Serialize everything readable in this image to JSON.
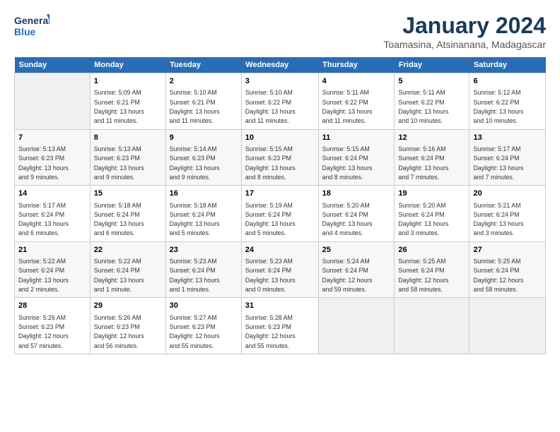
{
  "logo": {
    "line1": "General",
    "line2": "Blue"
  },
  "header": {
    "title": "January 2024",
    "subtitle": "Toamasina, Atsinanana, Madagascar"
  },
  "days_of_week": [
    "Sunday",
    "Monday",
    "Tuesday",
    "Wednesday",
    "Thursday",
    "Friday",
    "Saturday"
  ],
  "weeks": [
    [
      {
        "day": "",
        "info": ""
      },
      {
        "day": "1",
        "info": "Sunrise: 5:09 AM\nSunset: 6:21 PM\nDaylight: 13 hours\nand 11 minutes."
      },
      {
        "day": "2",
        "info": "Sunrise: 5:10 AM\nSunset: 6:21 PM\nDaylight: 13 hours\nand 11 minutes."
      },
      {
        "day": "3",
        "info": "Sunrise: 5:10 AM\nSunset: 6:22 PM\nDaylight: 13 hours\nand 11 minutes."
      },
      {
        "day": "4",
        "info": "Sunrise: 5:11 AM\nSunset: 6:22 PM\nDaylight: 13 hours\nand 11 minutes."
      },
      {
        "day": "5",
        "info": "Sunrise: 5:11 AM\nSunset: 6:22 PM\nDaylight: 13 hours\nand 10 minutes."
      },
      {
        "day": "6",
        "info": "Sunrise: 5:12 AM\nSunset: 6:22 PM\nDaylight: 13 hours\nand 10 minutes."
      }
    ],
    [
      {
        "day": "7",
        "info": "Sunrise: 5:13 AM\nSunset: 6:23 PM\nDaylight: 13 hours\nand 9 minutes."
      },
      {
        "day": "8",
        "info": "Sunrise: 5:13 AM\nSunset: 6:23 PM\nDaylight: 13 hours\nand 9 minutes."
      },
      {
        "day": "9",
        "info": "Sunrise: 5:14 AM\nSunset: 6:23 PM\nDaylight: 13 hours\nand 9 minutes."
      },
      {
        "day": "10",
        "info": "Sunrise: 5:15 AM\nSunset: 6:23 PM\nDaylight: 13 hours\nand 8 minutes."
      },
      {
        "day": "11",
        "info": "Sunrise: 5:15 AM\nSunset: 6:24 PM\nDaylight: 13 hours\nand 8 minutes."
      },
      {
        "day": "12",
        "info": "Sunrise: 5:16 AM\nSunset: 6:24 PM\nDaylight: 13 hours\nand 7 minutes."
      },
      {
        "day": "13",
        "info": "Sunrise: 5:17 AM\nSunset: 6:24 PM\nDaylight: 13 hours\nand 7 minutes."
      }
    ],
    [
      {
        "day": "14",
        "info": "Sunrise: 5:17 AM\nSunset: 6:24 PM\nDaylight: 13 hours\nand 6 minutes."
      },
      {
        "day": "15",
        "info": "Sunrise: 5:18 AM\nSunset: 6:24 PM\nDaylight: 13 hours\nand 6 minutes."
      },
      {
        "day": "16",
        "info": "Sunrise: 5:18 AM\nSunset: 6:24 PM\nDaylight: 13 hours\nand 5 minutes."
      },
      {
        "day": "17",
        "info": "Sunrise: 5:19 AM\nSunset: 6:24 PM\nDaylight: 13 hours\nand 5 minutes."
      },
      {
        "day": "18",
        "info": "Sunrise: 5:20 AM\nSunset: 6:24 PM\nDaylight: 13 hours\nand 4 minutes."
      },
      {
        "day": "19",
        "info": "Sunrise: 5:20 AM\nSunset: 6:24 PM\nDaylight: 13 hours\nand 3 minutes."
      },
      {
        "day": "20",
        "info": "Sunrise: 5:21 AM\nSunset: 6:24 PM\nDaylight: 13 hours\nand 3 minutes."
      }
    ],
    [
      {
        "day": "21",
        "info": "Sunrise: 5:22 AM\nSunset: 6:24 PM\nDaylight: 13 hours\nand 2 minutes."
      },
      {
        "day": "22",
        "info": "Sunrise: 5:22 AM\nSunset: 6:24 PM\nDaylight: 13 hours\nand 1 minute."
      },
      {
        "day": "23",
        "info": "Sunrise: 5:23 AM\nSunset: 6:24 PM\nDaylight: 13 hours\nand 1 minutes."
      },
      {
        "day": "24",
        "info": "Sunrise: 5:23 AM\nSunset: 6:24 PM\nDaylight: 13 hours\nand 0 minutes."
      },
      {
        "day": "25",
        "info": "Sunrise: 5:24 AM\nSunset: 6:24 PM\nDaylight: 12 hours\nand 59 minutes."
      },
      {
        "day": "26",
        "info": "Sunrise: 5:25 AM\nSunset: 6:24 PM\nDaylight: 12 hours\nand 58 minutes."
      },
      {
        "day": "27",
        "info": "Sunrise: 5:25 AM\nSunset: 6:24 PM\nDaylight: 12 hours\nand 58 minutes."
      }
    ],
    [
      {
        "day": "28",
        "info": "Sunrise: 5:26 AM\nSunset: 6:23 PM\nDaylight: 12 hours\nand 57 minutes."
      },
      {
        "day": "29",
        "info": "Sunrise: 5:26 AM\nSunset: 6:23 PM\nDaylight: 12 hours\nand 56 minutes."
      },
      {
        "day": "30",
        "info": "Sunrise: 5:27 AM\nSunset: 6:23 PM\nDaylight: 12 hours\nand 55 minutes."
      },
      {
        "day": "31",
        "info": "Sunrise: 5:28 AM\nSunset: 6:23 PM\nDaylight: 12 hours\nand 55 minutes."
      },
      {
        "day": "",
        "info": ""
      },
      {
        "day": "",
        "info": ""
      },
      {
        "day": "",
        "info": ""
      }
    ]
  ]
}
